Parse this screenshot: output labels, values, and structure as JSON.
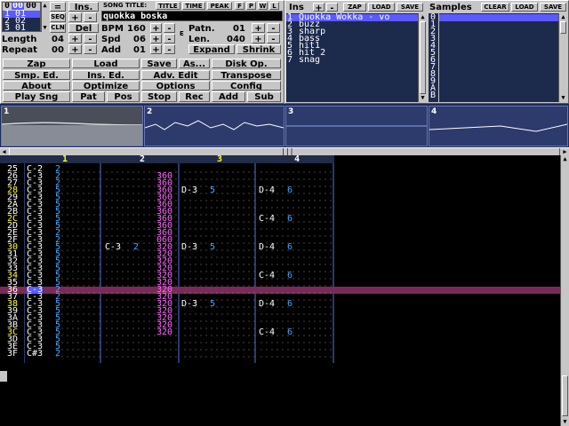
{
  "song": {
    "title_label": "SONG TITLE:",
    "title": "quokka boska",
    "sort_tabs": [
      "TITLE",
      "TIME",
      "PEAK"
    ],
    "flags": [
      "F",
      "P",
      "W",
      "L"
    ]
  },
  "orders": {
    "rows": [
      {
        "pos": "0",
        "pat": "00"
      },
      {
        "pos": "1",
        "pat": "01"
      },
      {
        "pos": "2",
        "pat": "02"
      },
      {
        "pos": "3",
        "pat": "01"
      }
    ],
    "header_a": "0",
    "header_b": "00"
  },
  "small_buttons": {
    "eq": "=",
    "seq": "SEQ",
    "cln": "CLN",
    "ins": "Ins.",
    "del": "Del",
    "plus": "+",
    "minus": "-"
  },
  "params": {
    "length_label": "Length",
    "length": "04",
    "repeat_label": "Repeat",
    "repeat": "00",
    "bpm_label": "BPM",
    "bpm": "160",
    "spd_label": "Spd",
    "spd": "06",
    "add_label": "Add",
    "add": "01",
    "patn_label": "Patn.",
    "patn": "01",
    "len_label": "Len.",
    "len": "040",
    "expand": "Expand",
    "shrink": "Shrink",
    "side_tag": "E"
  },
  "main_buttons": [
    [
      "Zap",
      "Load",
      "Save",
      "As...",
      "Disk Op."
    ],
    [
      "Smp. Ed.",
      "Ins. Ed.",
      "Adv. Edit",
      "Transpose"
    ],
    [
      "About",
      "Optimize",
      "Options",
      "Config"
    ],
    [
      "Play Sng",
      "Pat",
      "Pos",
      "Stop",
      "Rec",
      "Add",
      "Sub"
    ]
  ],
  "instruments": {
    "label": "Ins",
    "buttons": [
      "+",
      "-",
      "ZAP",
      "LOAD",
      "SAVE"
    ],
    "items": [
      {
        "num": "1",
        "name": "Quokka Wokka - vo"
      },
      {
        "num": "2",
        "name": "buzz"
      },
      {
        "num": "3",
        "name": "sharp"
      },
      {
        "num": "4",
        "name": "bass"
      },
      {
        "num": "5",
        "name": "hit1"
      },
      {
        "num": "6",
        "name": "hit 2"
      },
      {
        "num": "7",
        "name": "snag"
      }
    ]
  },
  "samples": {
    "label": "Samples",
    "buttons": [
      "CLEAR",
      "LOAD",
      "SAVE"
    ],
    "nums": [
      "0",
      "1",
      "2",
      "3",
      "4",
      "5",
      "6",
      "7",
      "8",
      "9",
      "A",
      "B"
    ]
  },
  "scopes": [
    "1",
    "2",
    "3",
    "4"
  ],
  "channels": [
    "1",
    "2",
    "3",
    "4"
  ],
  "colors": {
    "navy": "#202c48",
    "panel": "#c6c6c6",
    "cursor_row": "#7a2a58",
    "note": "#ffffff",
    "ins": "#4aa6ff",
    "vol": "#ff66ff",
    "highlight": "#ffff33"
  },
  "pattern": {
    "rows": [
      {
        "n": "25",
        "c1": "C-2",
        "i1": "2",
        "v2": "",
        "c3": "",
        "i3": "",
        "c4": "",
        "i4": ""
      },
      {
        "n": "26",
        "c1": "C-3",
        "i1": "2",
        "v2": "360",
        "c3": "",
        "i3": "",
        "c4": "",
        "i4": ""
      },
      {
        "n": "27",
        "c1": "C-3",
        "i1": "2",
        "v2": "360",
        "c3": "",
        "i3": "",
        "c4": "",
        "i4": ""
      },
      {
        "n": "28",
        "c1": "C-3",
        "i1": "5",
        "v2": "360",
        "c3": "D-3",
        "i3": "5",
        "c4": "D-4",
        "i4": "6",
        "hl": true
      },
      {
        "n": "29",
        "c1": "C-3",
        "i1": "5",
        "v2": "360",
        "c3": "",
        "i3": "",
        "c4": "",
        "i4": ""
      },
      {
        "n": "2A",
        "c1": "C-3",
        "i1": "5",
        "v2": "360",
        "c3": "",
        "i3": "",
        "c4": "",
        "i4": ""
      },
      {
        "n": "2B",
        "c1": "C-3",
        "i1": "5",
        "v2": "360",
        "c3": "",
        "i3": "",
        "c4": "",
        "i4": ""
      },
      {
        "n": "2C",
        "c1": "C-3",
        "i1": "5",
        "v2": "360",
        "c3": "",
        "i3": "",
        "c4": "C-4",
        "i4": "6",
        "hl": true
      },
      {
        "n": "2D",
        "c1": "C-3",
        "i1": "5",
        "v2": "360",
        "c3": "",
        "i3": "",
        "c4": "",
        "i4": ""
      },
      {
        "n": "2E",
        "c1": "C-3",
        "i1": "2",
        "v2": "360",
        "c3": "",
        "i3": "",
        "c4": "",
        "i4": ""
      },
      {
        "n": "2F",
        "c1": "C-3",
        "i1": "2",
        "v2": "060",
        "c3": "",
        "i3": "",
        "c4": "",
        "i4": ""
      },
      {
        "n": "30",
        "c1": "C-3",
        "i1": "5",
        "c2": "C-3",
        "i2": "2",
        "v2": "320",
        "c3": "D-3",
        "i3": "5",
        "c4": "D-4",
        "i4": "6",
        "hl": true
      },
      {
        "n": "31",
        "c1": "C-3",
        "i1": "5",
        "v2": "320",
        "c3": "",
        "i3": "",
        "c4": "",
        "i4": ""
      },
      {
        "n": "32",
        "c1": "C-3",
        "i1": "5",
        "v2": "320",
        "c3": "",
        "i3": "",
        "c4": "",
        "i4": ""
      },
      {
        "n": "33",
        "c1": "C-3",
        "i1": "5",
        "v2": "320",
        "c3": "",
        "i3": "",
        "c4": "",
        "i4": ""
      },
      {
        "n": "34",
        "c1": "C-3",
        "i1": "5",
        "v2": "320",
        "c3": "",
        "i3": "",
        "c4": "C-4",
        "i4": "6",
        "hl": true
      },
      {
        "n": "35",
        "c1": "C-3",
        "i1": "5",
        "v2": "320",
        "c3": "",
        "i3": "",
        "c4": "",
        "i4": ""
      },
      {
        "n": "36",
        "c1": "C-3",
        "i1": "2",
        "v2": "320",
        "c3": "",
        "i3": "",
        "c4": "",
        "i4": "",
        "cursor": true
      },
      {
        "n": "37",
        "c1": "C-3",
        "i1": "2",
        "v2": "320",
        "c3": "",
        "i3": "",
        "c4": "",
        "i4": ""
      },
      {
        "n": "38",
        "c1": "C-3",
        "i1": "5",
        "v2": "320",
        "c3": "D-3",
        "i3": "5",
        "c4": "D-4",
        "i4": "6",
        "hl": true
      },
      {
        "n": "39",
        "c1": "C-3",
        "i1": "5",
        "v2": "320",
        "c3": "",
        "i3": "",
        "c4": "",
        "i4": ""
      },
      {
        "n": "3A",
        "c1": "C-3",
        "i1": "5",
        "v2": "320",
        "c3": "",
        "i3": "",
        "c4": "",
        "i4": ""
      },
      {
        "n": "3B",
        "c1": "C-3",
        "i1": "5",
        "v2": "320",
        "c3": "",
        "i3": "",
        "c4": "",
        "i4": ""
      },
      {
        "n": "3C",
        "c1": "C-3",
        "i1": "5",
        "v2": "320",
        "c3": "",
        "i3": "",
        "c4": "C-4",
        "i4": "6",
        "hl": true
      },
      {
        "n": "3D",
        "c1": "C-3",
        "i1": "5",
        "v2": "",
        "c3": "",
        "i3": "",
        "c4": "",
        "i4": ""
      },
      {
        "n": "3E",
        "c1": "C-3",
        "i1": "5",
        "v2": "",
        "c3": "",
        "i3": "",
        "c4": "",
        "i4": ""
      },
      {
        "n": "3F",
        "c1": "C#3",
        "i1": "2",
        "v2": "",
        "c3": "",
        "i3": "",
        "c4": "",
        "i4": ""
      }
    ]
  }
}
